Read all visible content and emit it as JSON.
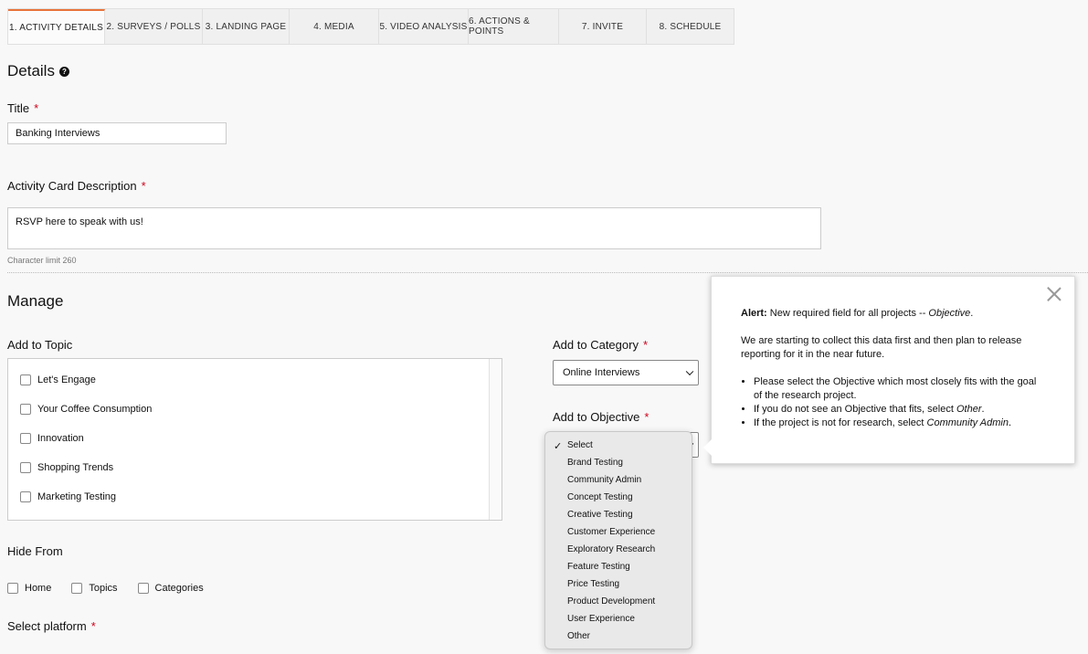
{
  "tabs": [
    {
      "label": "1. Activity Details",
      "width": 106,
      "active": true
    },
    {
      "label": "2. Surveys / Polls",
      "width": 107
    },
    {
      "label": "3. Landing Page",
      "width": 95
    },
    {
      "label": "4. Media",
      "width": 98
    },
    {
      "label": "5. Video Analysis",
      "width": 98
    },
    {
      "label": "6. Actions & Points",
      "width": 99
    },
    {
      "label": "7. Invite",
      "width": 96
    },
    {
      "label": "8. Schedule",
      "width": 95
    }
  ],
  "details": {
    "heading": "Details",
    "title_label": "Title",
    "title_value": "Banking Interviews",
    "desc_label": "Activity Card Description",
    "desc_value": "RSVP here to speak with us!",
    "char_limit": "Character limit 260"
  },
  "manage": {
    "heading": "Manage",
    "topic_label": "Add to Topic",
    "topics": [
      "Let's Engage",
      "Your Coffee Consumption",
      "Innovation",
      "Shopping Trends",
      "Marketing Testing"
    ],
    "category_label": "Add to Category",
    "category_value": "Online Interviews",
    "objective_label": "Add to Objective",
    "objective_options": [
      "Select",
      "Brand Testing",
      "Community Admin",
      "Concept Testing",
      "Creative Testing",
      "Customer Experience",
      "Exploratory Research",
      "Feature Testing",
      "Price Testing",
      "Product Development",
      "User Experience",
      "Other"
    ],
    "hide_label": "Hide From",
    "hide_options": [
      "Home",
      "Topics",
      "Categories"
    ],
    "platform_label": "Select platform"
  },
  "required_mark": "*",
  "help_glyph": "?",
  "check_glyph": "✓",
  "alert": {
    "bold": "Alert:",
    "text": " New required field for all projects -- ",
    "italic": "Objective",
    "end": ".",
    "para2": "We are starting to collect this data first and then plan to release reporting for it in the near future.",
    "bullet1": "Please select the Objective which most closely fits with the goal of the research project.",
    "bullet2_pre": "If you do not see an Objective that fits, select ",
    "bullet2_em": "Other",
    "bullet2_post": ".",
    "bullet3_pre": "If the project is not for research, select ",
    "bullet3_em": "Community Admin",
    "bullet3_post": "."
  },
  "colors": {
    "accent": "#e8743b",
    "required": "#d0021b"
  }
}
